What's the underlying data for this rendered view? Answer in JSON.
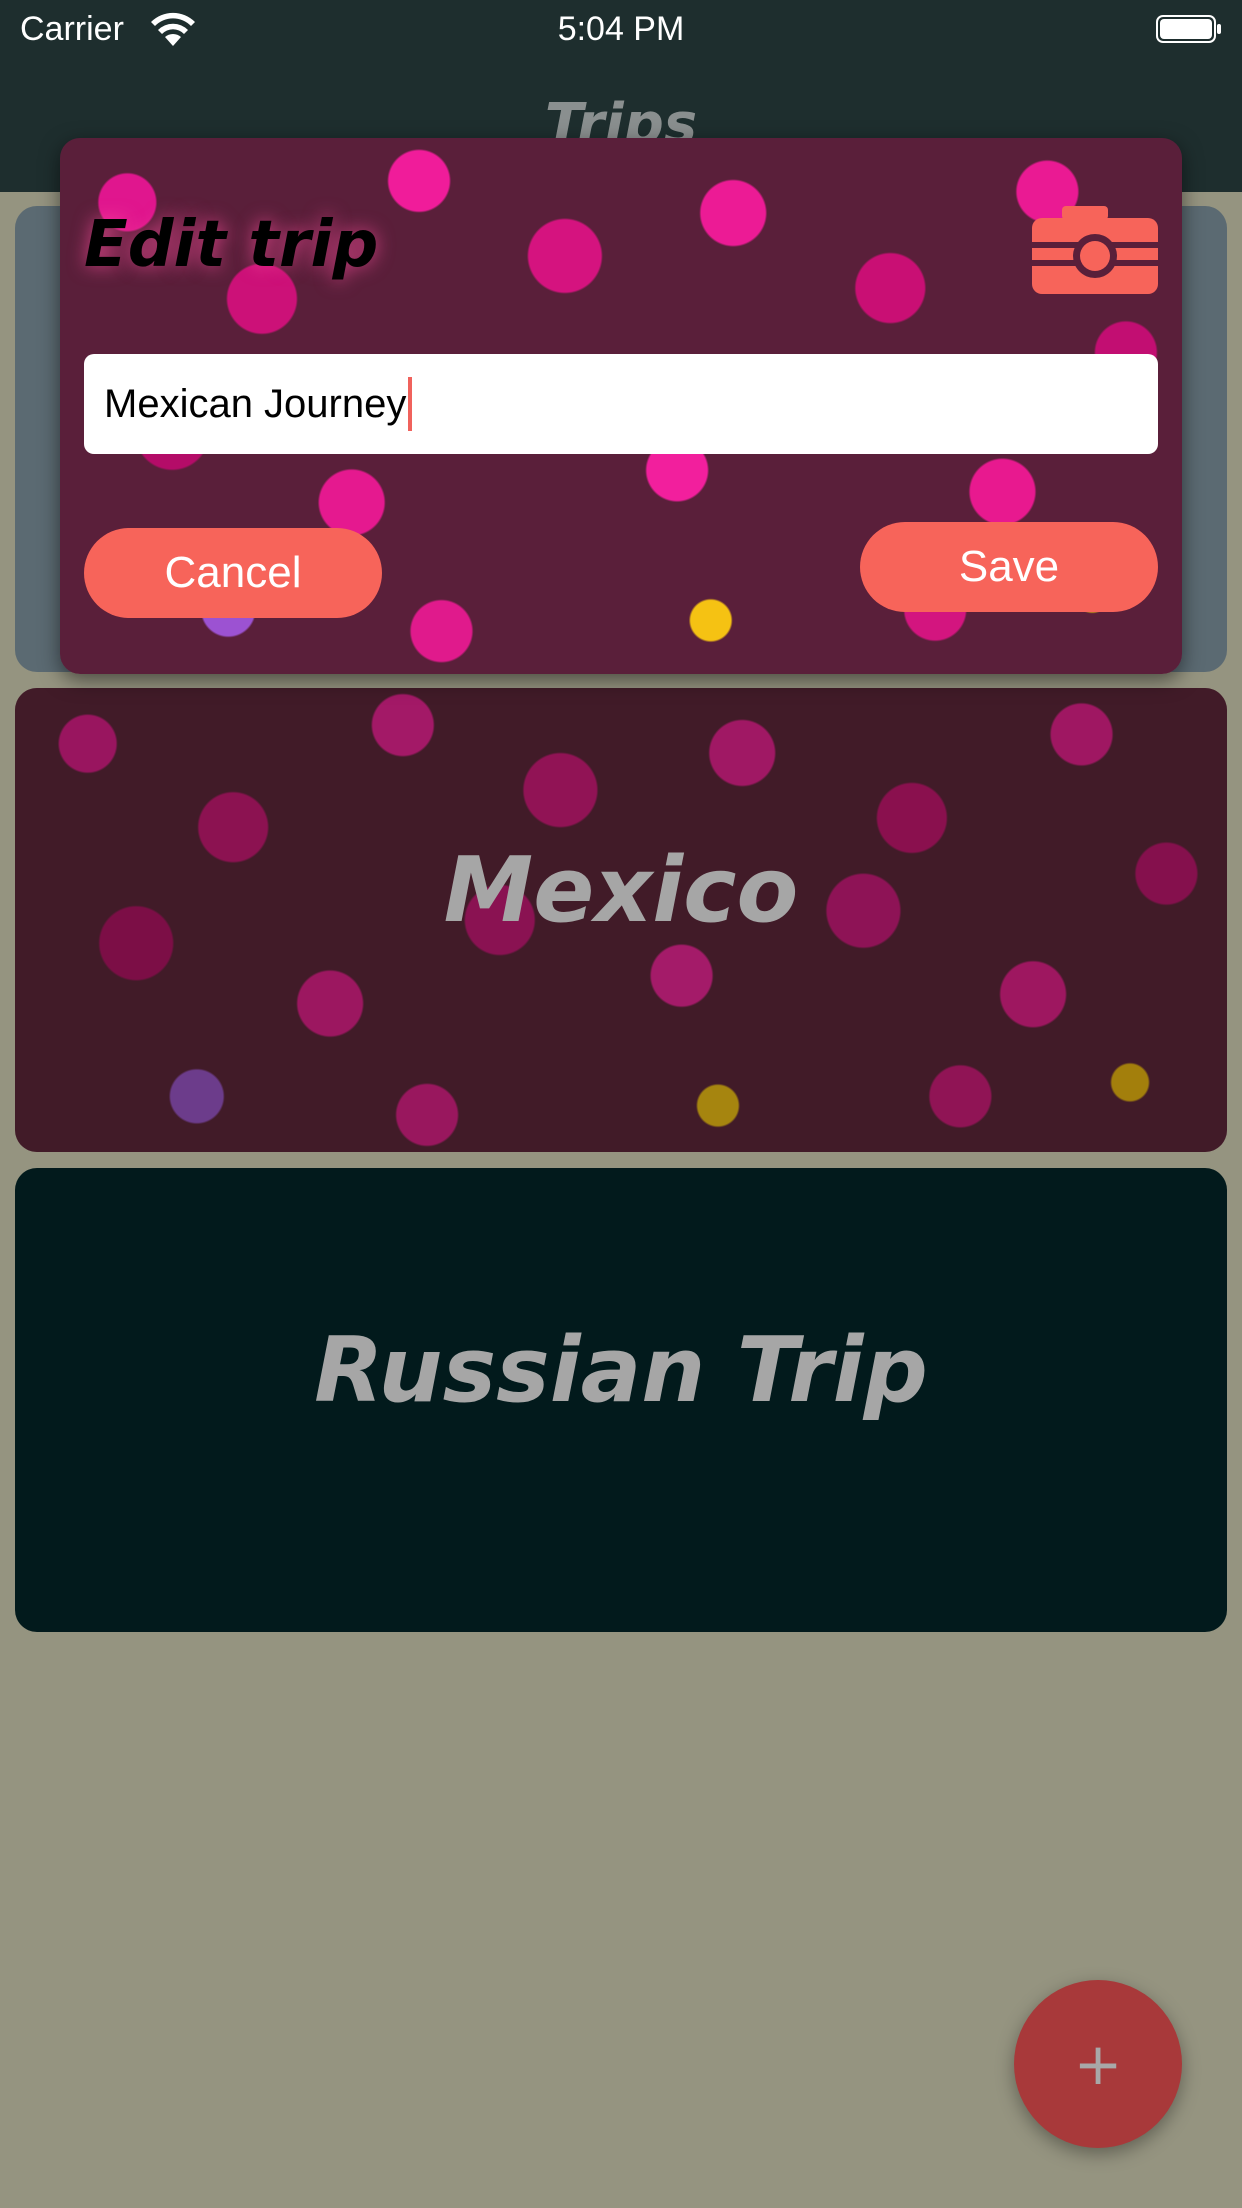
{
  "status_bar": {
    "carrier": "Carrier",
    "time": "5:04 PM"
  },
  "nav": {
    "title": "Trips"
  },
  "trips": [
    {
      "label": ""
    },
    {
      "label": "Mexico"
    },
    {
      "label": "Russian Trip"
    }
  ],
  "modal": {
    "title": "Edit trip",
    "name_value": "Mexican Journey",
    "cancel_label": "Cancel",
    "save_label": "Save",
    "camera_icon": "camera-icon"
  },
  "fab": {
    "label": "+"
  },
  "colors": {
    "accent": "#f7645a",
    "nav_background": "#1e2e2e",
    "page_background": "#959480",
    "fab": "#a8393a"
  }
}
